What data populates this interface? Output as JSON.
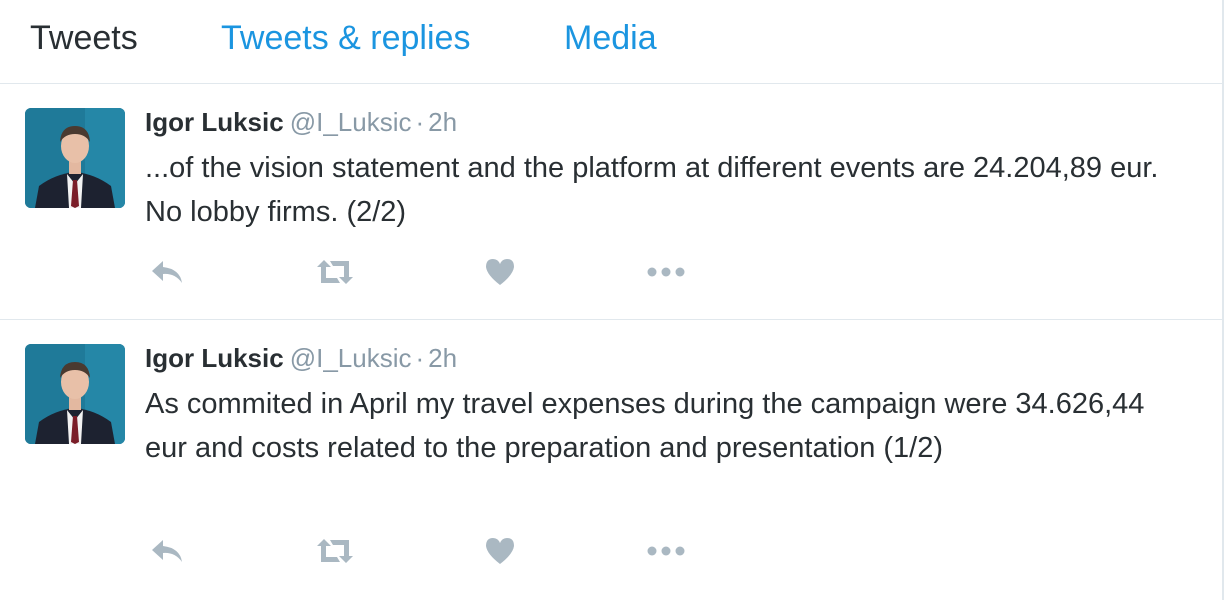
{
  "tabs": [
    {
      "label": "Tweets",
      "active": true
    },
    {
      "label": "Tweets & replies",
      "active": false
    },
    {
      "label": "Media",
      "active": false
    }
  ],
  "colors": {
    "link": "#1b95e0",
    "text": "#292f33",
    "muted": "#8899a6",
    "icon": "#aab8c2",
    "divider": "#e1e8ed"
  },
  "tweets": [
    {
      "fullname": "Igor Luksic",
      "handle": "@I_Luksic",
      "separator": "·",
      "time": "2h",
      "text": "...of the vision statement and the platform at different events are 24.204,89 eur. No lobby firms. (2/2)",
      "actions": [
        "reply-icon",
        "retweet-icon",
        "heart-icon",
        "more-icon"
      ]
    },
    {
      "fullname": "Igor Luksic",
      "handle": "@I_Luksic",
      "separator": "·",
      "time": "2h",
      "text": "As commited in April my travel expenses during the campaign were 34.626,44 eur and costs related to the preparation and presentation (1/2)",
      "actions": [
        "reply-icon",
        "retweet-icon",
        "heart-icon",
        "more-icon"
      ]
    }
  ]
}
